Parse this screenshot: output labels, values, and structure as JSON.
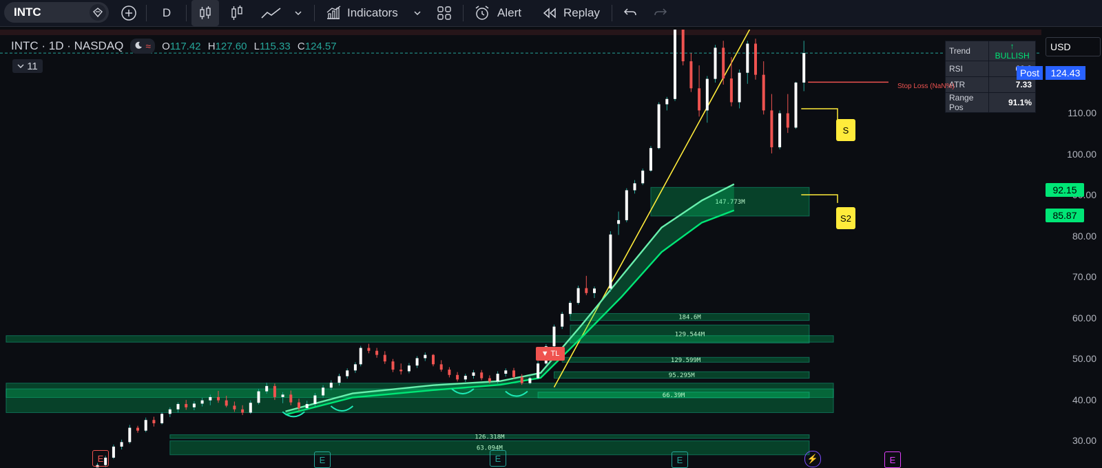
{
  "toolbar": {
    "symbol": "INTC",
    "interval": "D",
    "indicators_label": "Indicators",
    "alert_label": "Alert",
    "replay_label": "Replay"
  },
  "legend": {
    "title": "INTC · 1D · NASDAQ",
    "open_label": "O",
    "open": "117.42",
    "high_label": "H",
    "high": "127.60",
    "low_label": "L",
    "low": "115.33",
    "close_label": "C",
    "close": "124.57",
    "collapsed_count": "11"
  },
  "info_table": {
    "rows": [
      {
        "label": "Trend",
        "value": "↑ BULLISH"
      },
      {
        "label": "RSI",
        "value": "69.3"
      },
      {
        "label": "ATR",
        "value": "7.33"
      },
      {
        "label": "Range Pos",
        "value": "91.1%"
      }
    ]
  },
  "price_axis": {
    "currency": "USD",
    "post_label": "Post",
    "post_value": "124.43",
    "badge_upper": "92.15",
    "badge_lower": "85.87",
    "badge_color": "#00e676",
    "post_color": "#2962ff"
  },
  "annotations": {
    "stop_loss": "Stop Loss (NaN%)",
    "support_1": "S",
    "support_2": "S2",
    "trendline_break": "▼ TL",
    "earnings_marker": "E"
  },
  "chart_data": {
    "type": "candlestick",
    "title": "INTC · 1D · NASDAQ",
    "ylim": [
      27,
      130
    ],
    "yticks": [
      30,
      40,
      50,
      60,
      70,
      80,
      90,
      100,
      110
    ],
    "ytick_labels": [
      "30.00",
      "40.00",
      "50.00",
      "60.00",
      "70.00",
      "80.00",
      "90.00",
      "100.00",
      "110.00"
    ],
    "candles": [
      [
        20,
        20.5,
        21.3,
        19.8,
        21.0
      ],
      [
        24,
        21.0,
        21.8,
        20.6,
        21.5
      ],
      [
        28,
        21.5,
        22.1,
        20.9,
        21.2
      ],
      [
        32,
        21.2,
        22.4,
        21.0,
        22.2
      ],
      [
        35,
        22.2,
        24.5,
        22.0,
        24.0
      ],
      [
        38,
        24.0,
        26.3,
        23.5,
        25.8
      ],
      [
        41,
        25.8,
        29.0,
        25.5,
        28.5
      ],
      [
        44,
        28.5,
        30.2,
        27.8,
        29.6
      ],
      [
        47,
        29.6,
        33.8,
        29.2,
        33.1
      ],
      [
        50,
        33.1,
        33.6,
        31.9,
        32.4
      ],
      [
        53,
        32.4,
        35.6,
        32.0,
        35.0
      ],
      [
        56,
        35.0,
        35.8,
        33.4,
        34.2
      ],
      [
        59,
        34.2,
        36.9,
        33.9,
        36.5
      ],
      [
        62,
        36.5,
        38.1,
        35.7,
        37.6
      ],
      [
        65,
        37.6,
        39.3,
        36.8,
        38.9
      ],
      [
        68,
        38.9,
        39.9,
        37.5,
        38.1
      ],
      [
        71,
        38.1,
        39.6,
        37.4,
        39.0
      ],
      [
        74,
        39.0,
        40.4,
        38.3,
        39.8
      ],
      [
        77,
        39.8,
        41.2,
        38.6,
        40.6
      ],
      [
        80,
        40.6,
        42.1,
        39.2,
        39.8
      ],
      [
        83,
        39.8,
        40.9,
        38.1,
        38.5
      ],
      [
        86,
        38.5,
        39.5,
        37.0,
        37.6
      ],
      [
        89,
        37.6,
        38.6,
        36.2,
        36.8
      ],
      [
        92,
        36.8,
        39.8,
        36.5,
        39.2
      ],
      [
        95,
        39.2,
        42.6,
        38.8,
        42.0
      ],
      [
        98,
        42.0,
        44.1,
        41.4,
        43.3
      ],
      [
        101,
        43.3,
        43.9,
        39.9,
        40.6
      ],
      [
        104,
        40.6,
        41.8,
        39.1,
        41.2
      ],
      [
        107,
        41.2,
        42.2,
        38.6,
        39.3
      ],
      [
        110,
        39.3,
        40.2,
        37.2,
        37.9
      ],
      [
        113,
        37.9,
        39.7,
        37.4,
        38.9
      ],
      [
        116,
        38.9,
        41.6,
        38.3,
        41.0
      ],
      [
        119,
        41.0,
        43.5,
        40.4,
        42.9
      ],
      [
        122,
        42.9,
        44.7,
        42.3,
        44.1
      ],
      [
        125,
        44.1,
        46.3,
        43.4,
        45.7
      ],
      [
        128,
        45.7,
        47.6,
        45.1,
        47.1
      ],
      [
        131,
        47.1,
        49.1,
        46.5,
        48.6
      ],
      [
        133,
        48.6,
        53.1,
        48.1,
        52.6
      ],
      [
        136,
        52.6,
        53.6,
        51.3,
        51.9
      ],
      [
        139,
        51.9,
        52.6,
        50.2,
        50.9
      ],
      [
        142,
        50.9,
        51.8,
        48.7,
        49.3
      ],
      [
        145,
        49.3,
        49.9,
        46.7,
        47.3
      ],
      [
        148,
        47.3,
        48.8,
        46.1,
        46.9
      ],
      [
        151,
        46.9,
        48.9,
        46.4,
        48.3
      ],
      [
        154,
        48.3,
        50.6,
        47.7,
        50.1
      ],
      [
        157,
        50.1,
        51.5,
        49.4,
        50.9
      ],
      [
        160,
        50.9,
        51.1,
        48.1,
        48.6
      ],
      [
        163,
        48.6,
        49.6,
        46.8,
        47.3
      ],
      [
        166,
        47.3,
        47.9,
        45.4,
        46.0
      ],
      [
        169,
        46.0,
        46.7,
        44.4,
        44.9
      ],
      [
        172,
        44.9,
        46.3,
        44.3,
        45.8
      ],
      [
        175,
        45.8,
        47.2,
        45.1,
        46.6
      ],
      [
        178,
        46.6,
        47.2,
        44.7,
        45.2
      ],
      [
        181,
        45.2,
        45.9,
        43.9,
        44.4
      ],
      [
        184,
        44.4,
        46.9,
        43.9,
        46.3
      ],
      [
        187,
        46.3,
        47.6,
        45.6,
        47.1
      ],
      [
        190,
        47.1,
        47.7,
        45.0,
        45.5
      ],
      [
        193,
        45.5,
        46.2,
        43.6,
        44.0
      ],
      [
        196,
        44.0,
        45.6,
        43.7,
        45.2
      ],
      [
        199,
        45.2,
        49.4,
        44.9,
        48.8
      ],
      [
        202,
        48.8,
        53.5,
        48.5,
        53.0
      ],
      [
        205,
        53.0,
        58.3,
        52.6,
        57.8
      ],
      [
        208,
        57.8,
        61.4,
        57.2,
        60.9
      ],
      [
        211,
        60.9,
        64.1,
        60.3,
        63.6
      ],
      [
        214,
        63.6,
        67.8,
        63.2,
        67.2
      ],
      [
        217,
        67.2,
        70.2,
        65.5,
        66.0
      ],
      [
        220,
        66.0,
        67.6,
        64.8,
        67.1
      ],
      [
        226,
        67.1,
        81.1,
        66.3,
        80.3
      ],
      [
        229,
        82.9,
        85.9,
        80.2,
        83.8
      ],
      [
        232,
        83.8,
        91.6,
        83.3,
        91.1
      ],
      [
        235,
        91.1,
        93.6,
        90.3,
        92.8
      ],
      [
        238,
        92.8,
        96.4,
        92.4,
        95.9
      ],
      [
        241,
        95.9,
        101.9,
        95.6,
        101.4
      ],
      [
        244,
        101.4,
        112.6,
        101.1,
        112.1
      ],
      [
        247,
        112.1,
        113.9,
        110.6,
        113.4
      ],
      [
        250,
        113.4,
        131.6,
        112.9,
        130.6
      ],
      [
        253,
        130.6,
        132.9,
        121.6,
        122.6
      ],
      [
        256,
        122.6,
        124.6,
        115.1,
        116.0
      ],
      [
        259,
        116.0,
        121.6,
        109.1,
        110.6
      ],
      [
        262,
        110.6,
        119.0,
        107.6,
        118.3
      ],
      [
        265,
        118.3,
        126.6,
        117.4,
        125.9
      ],
      [
        268,
        125.9,
        127.6,
        116.9,
        118.4
      ],
      [
        271,
        118.4,
        123.6,
        111.6,
        112.6
      ],
      [
        274,
        112.6,
        120.6,
        111.1,
        119.8
      ],
      [
        277,
        119.8,
        127.6,
        117.1,
        126.9
      ],
      [
        280,
        126.9,
        128.1,
        118.1,
        119.3
      ],
      [
        283,
        119.3,
        122.6,
        109.6,
        110.6
      ],
      [
        286,
        110.6,
        114.6,
        100.1,
        101.6
      ],
      [
        289,
        101.6,
        110.6,
        101.1,
        109.9
      ],
      [
        292,
        109.9,
        114.6,
        105.1,
        106.4
      ],
      [
        295,
        106.4,
        117.6,
        106.1,
        117.4
      ],
      [
        298,
        117.4,
        127.6,
        115.3,
        124.6
      ]
    ],
    "ema_fast": [
      [
        105,
        37.1
      ],
      [
        130,
        41.5
      ],
      [
        160,
        43.5
      ],
      [
        185,
        44.5
      ],
      [
        200,
        46.5
      ],
      [
        215,
        58.0
      ],
      [
        230,
        70.0
      ],
      [
        245,
        82.0
      ],
      [
        260,
        88.6
      ],
      [
        272,
        92.6
      ]
    ],
    "ema_slow": [
      [
        105,
        36.3
      ],
      [
        130,
        40.5
      ],
      [
        160,
        42.3
      ],
      [
        185,
        43.6
      ],
      [
        200,
        45.3
      ],
      [
        215,
        55.0
      ],
      [
        230,
        65.0
      ],
      [
        245,
        76.0
      ],
      [
        260,
        83.2
      ],
      [
        272,
        86.2
      ]
    ],
    "trendline": [
      [
        205,
        43.0
      ],
      [
        280,
        133.0
      ]
    ],
    "stop_loss_level": 117.5,
    "zones": [
      {
        "x0": 1,
        "x1": 309,
        "ylo": 54.0,
        "yhi": 55.6,
        "label": ""
      },
      {
        "x0": 1,
        "x1": 309,
        "ylo": 40.5,
        "yhi": 44.0,
        "label": ""
      },
      {
        "x0": 1,
        "x1": 309,
        "ylo": 36.8,
        "yhi": 42.6,
        "label": ""
      },
      {
        "x0": 211,
        "x1": 300,
        "ylo": 59.3,
        "yhi": 61.0,
        "label": "184.6M"
      },
      {
        "x0": 211,
        "x1": 300,
        "ylo": 53.8,
        "yhi": 58.2,
        "label": "129.544M"
      },
      {
        "x0": 208,
        "x1": 300,
        "ylo": 49.1,
        "yhi": 50.3,
        "label": "129.599M"
      },
      {
        "x0": 205,
        "x1": 300,
        "ylo": 45.2,
        "yhi": 46.8,
        "label": "95.295M"
      },
      {
        "x0": 199,
        "x1": 300,
        "ylo": 40.4,
        "yhi": 41.8,
        "label": "66.39M"
      },
      {
        "x0": 241,
        "x1": 300,
        "ylo": 84.8,
        "yhi": 91.8,
        "label": "147.773M"
      },
      {
        "x0": 62,
        "x1": 300,
        "ylo": 30.5,
        "yhi": 31.4,
        "label": "126.318M"
      },
      {
        "x0": 62,
        "x1": 300,
        "ylo": 26.5,
        "yhi": 29.9,
        "label": "63.094M"
      }
    ]
  }
}
